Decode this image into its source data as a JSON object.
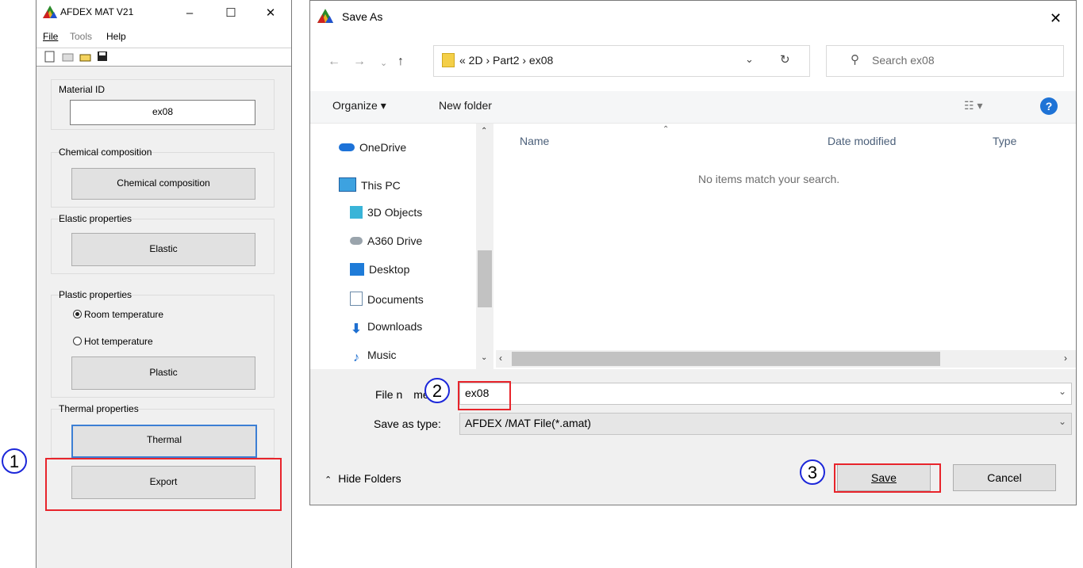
{
  "app": {
    "title": "AFDEX MAT V21",
    "window_controls": {
      "minimize": "–",
      "maximize": "☐",
      "close": "✕"
    },
    "menu": [
      "File",
      "Tools",
      "Help"
    ],
    "toolbar_icons": [
      "new-file-icon",
      "open-icon",
      "open-folder-icon",
      "save-icon"
    ],
    "material_id": {
      "label": "Material ID",
      "value": "ex08"
    },
    "chemical": {
      "label": "Chemical composition",
      "button": "Chemical composition"
    },
    "elastic": {
      "label": "Elastic properties",
      "button": "Elastic"
    },
    "plastic": {
      "label": "Plastic properties",
      "options": [
        "Room temperature",
        "Hot temperature"
      ],
      "selected": "Room temperature",
      "button": "Plastic"
    },
    "thermal": {
      "label": "Thermal properties",
      "button": "Thermal"
    },
    "export_button": "Export"
  },
  "dialog": {
    "title": "Save As",
    "close": "✕",
    "breadcrumb": "«  2D  ›  Part2  ›  ex08",
    "search_placeholder": "Search ex08",
    "organize": "Organize ▾",
    "new_folder": "New folder",
    "nav_items": [
      "OneDrive",
      "This PC",
      "3D Objects",
      "A360 Drive",
      "Desktop",
      "Documents",
      "Downloads",
      "Music"
    ],
    "columns": [
      "Name",
      "Date modified",
      "Type"
    ],
    "empty_message": "No items match your search.",
    "file_name_label": "File n",
    "file_name_label_suffix": "me:",
    "file_name_value": "ex08",
    "save_as_type_label": "Save as type:",
    "save_as_type_value": "AFDEX /MAT File(*.amat)",
    "hide_folders": "Hide Folders",
    "save": "Save",
    "cancel": "Cancel"
  },
  "steps": [
    "1",
    "2",
    "3"
  ],
  "colors": {
    "highlight": "#e8242b",
    "step_circle": "#1c27d9",
    "help": "#1e73d6"
  }
}
